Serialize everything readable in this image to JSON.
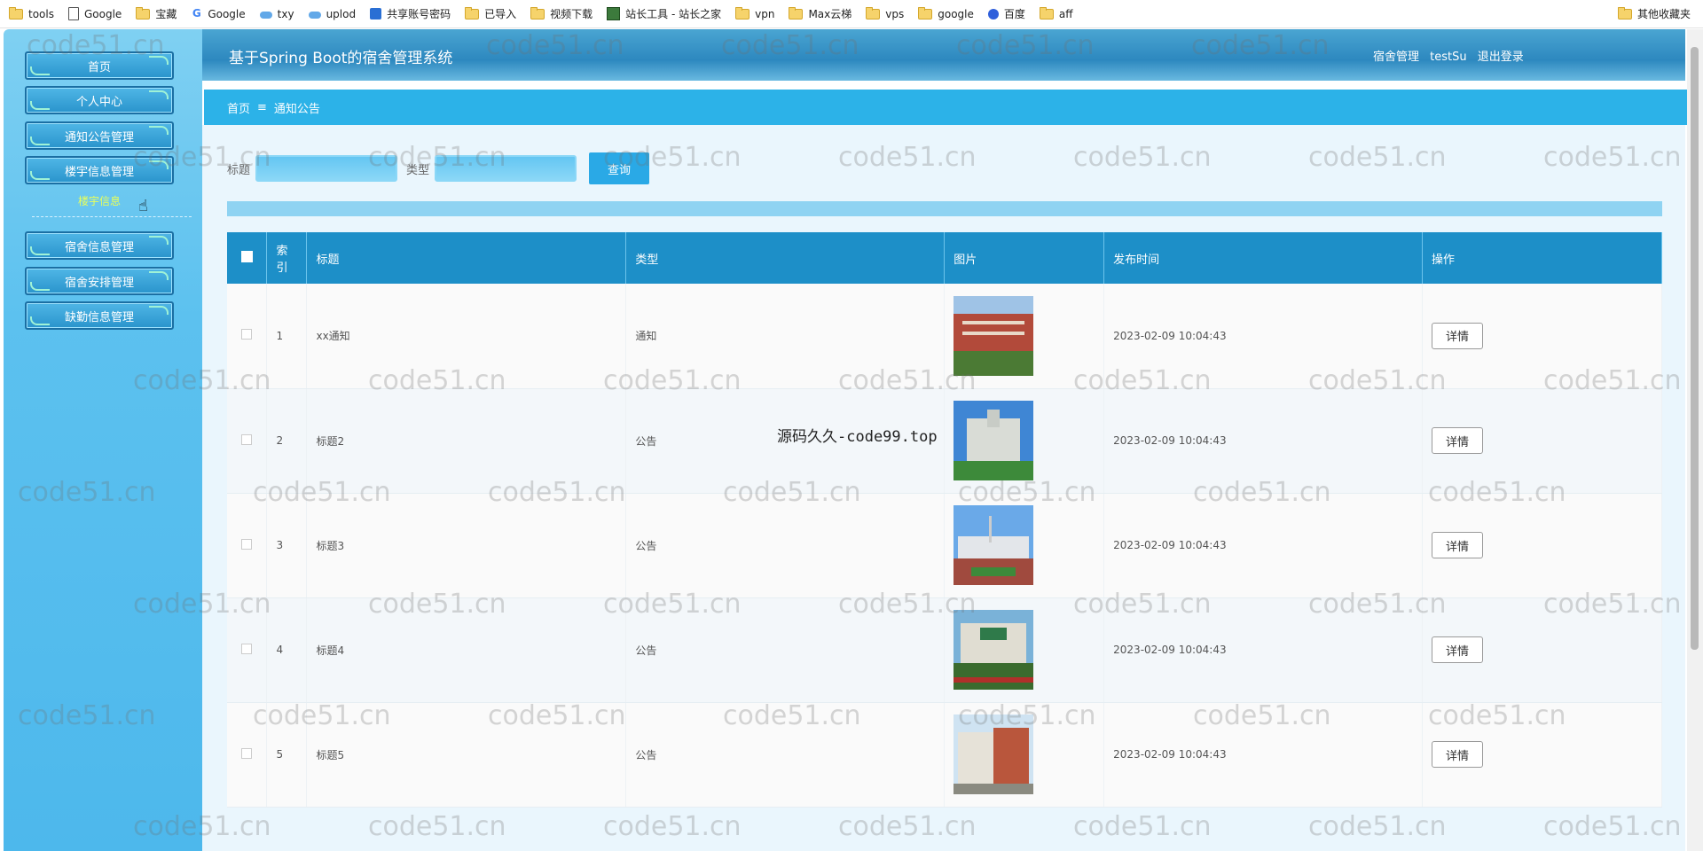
{
  "bookmarks": [
    {
      "label": "tools",
      "icon": "folder-icon"
    },
    {
      "label": "Google",
      "icon": "doc-icon"
    },
    {
      "label": "宝藏",
      "icon": "folder-icon"
    },
    {
      "label": "Google",
      "icon": "google-icon"
    },
    {
      "label": "txy",
      "icon": "cloud-icon"
    },
    {
      "label": "uplod",
      "icon": "cloud-icon"
    },
    {
      "label": "共享账号密码",
      "icon": "share-icon"
    },
    {
      "label": "已导入",
      "icon": "folder-icon"
    },
    {
      "label": "视频下载",
      "icon": "folder-icon"
    },
    {
      "label": "站长工具 - 站长之家",
      "icon": "tool-icon"
    },
    {
      "label": "vpn",
      "icon": "folder-icon"
    },
    {
      "label": "Max云梯",
      "icon": "folder-icon"
    },
    {
      "label": "vps",
      "icon": "folder-icon"
    },
    {
      "label": "google",
      "icon": "folder-icon"
    },
    {
      "label": "百度",
      "icon": "baidu-icon"
    },
    {
      "label": "aff",
      "icon": "folder-icon"
    }
  ],
  "bookmarks_other": "其他收藏夹",
  "sidebar": {
    "items": [
      {
        "label": "首页"
      },
      {
        "label": "个人中心"
      },
      {
        "label": "通知公告管理"
      },
      {
        "label": "楼宇信息管理"
      },
      {
        "label": "宿舍信息管理"
      },
      {
        "label": "宿舍安排管理"
      },
      {
        "label": "缺勤信息管理"
      }
    ],
    "submenu_label": "楼宇信息"
  },
  "header": {
    "title": "基于Spring Boot的宿舍管理系统",
    "role": "宿舍管理",
    "username": "testSu",
    "logout": "退出登录"
  },
  "breadcrumb": {
    "home": "首页",
    "separator": "≡",
    "current": "通知公告"
  },
  "search": {
    "title_label": "标题",
    "type_label": "类型",
    "button": "查询"
  },
  "table": {
    "headers": [
      "索引",
      "标题",
      "类型",
      "图片",
      "发布时间",
      "操作"
    ],
    "rows": [
      {
        "index": "1",
        "title": "xx通知",
        "type": "通知",
        "time": "2023-02-09 10:04:43",
        "action": "详情"
      },
      {
        "index": "2",
        "title": "标题2",
        "type": "公告",
        "time": "2023-02-09 10:04:43",
        "action": "详情"
      },
      {
        "index": "3",
        "title": "标题3",
        "type": "公告",
        "time": "2023-02-09 10:04:43",
        "action": "详情"
      },
      {
        "index": "4",
        "title": "标题4",
        "type": "公告",
        "time": "2023-02-09 10:04:43",
        "action": "详情"
      },
      {
        "index": "5",
        "title": "标题5",
        "type": "公告",
        "time": "2023-02-09 10:04:43",
        "action": "详情"
      }
    ]
  },
  "watermark": "code51.cn",
  "center_watermark": "源码久久-code99.top"
}
